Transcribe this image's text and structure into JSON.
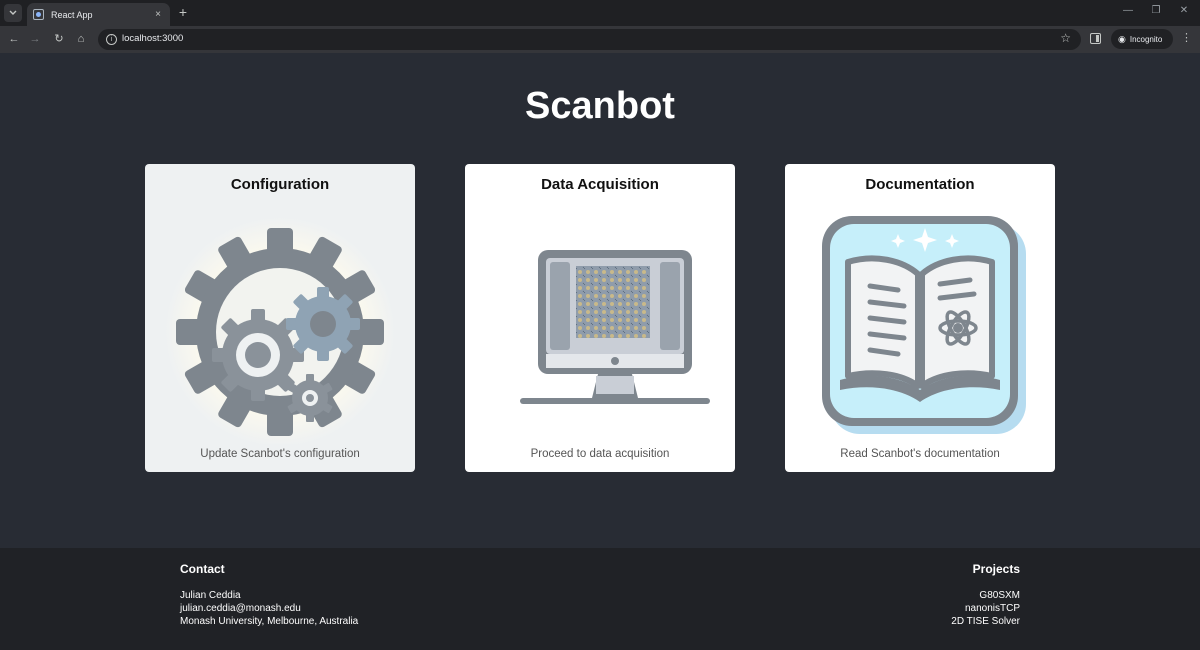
{
  "browser": {
    "tab_title": "React App",
    "tab_close": "×",
    "new_tab": "+",
    "url": "localhost:3000",
    "incognito_label": "Incognito",
    "icons": [
      "tab-search-icon",
      "favicon-icon",
      "close-icon",
      "plus-icon",
      "minimize-icon",
      "restore-icon",
      "window-close-icon",
      "back-icon",
      "forward-icon",
      "reload-icon",
      "home-icon",
      "info-icon",
      "star-icon",
      "side-panel-icon",
      "incognito-icon",
      "menu-icon"
    ]
  },
  "page": {
    "title": "Scanbot",
    "cards": [
      {
        "title": "Configuration",
        "description": "Update Scanbot's configuration",
        "icon": "gears-icon"
      },
      {
        "title": "Data Acquisition",
        "description": "Proceed to data acquisition",
        "icon": "monitor-icon"
      },
      {
        "title": "Documentation",
        "description": "Read Scanbot's documentation",
        "icon": "book-icon"
      }
    ]
  },
  "footer": {
    "contact": {
      "heading": "Contact",
      "lines": [
        "Julian Ceddia",
        "julian.ceddia@monash.edu",
        "Monash University, Melbourne, Australia"
      ]
    },
    "projects": {
      "heading": "Projects",
      "lines": [
        "G80SXM",
        "nanonisTCP",
        "2D TISE Solver"
      ]
    }
  },
  "colors": {
    "page_bg": "#282c34",
    "footer_bg": "#202226",
    "card_bg": "#ffffff",
    "card_active_bg": "#eef1f2",
    "icon_gray": "#7e868e"
  }
}
